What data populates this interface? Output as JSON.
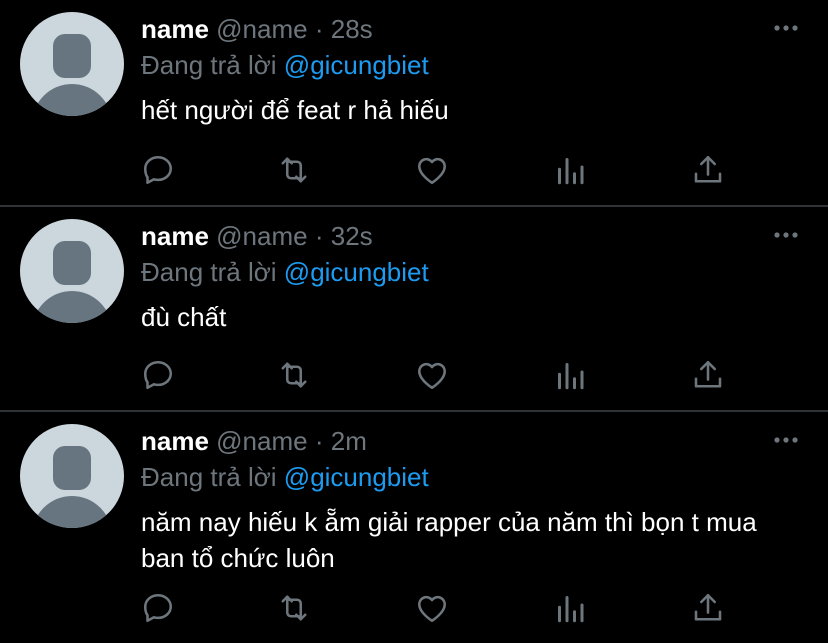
{
  "colors": {
    "background": "#000000",
    "divider": "#2f3336",
    "secondary_text": "#6e767d",
    "mention": "#1d9bf0",
    "avatar_bg": "#ccd6dd",
    "avatar_fg": "#66757f"
  },
  "reply_prefix": "Đang trả lời",
  "icons": {
    "more": "more-horizontal-icon",
    "reply": "reply-icon",
    "retweet": "retweet-icon",
    "like": "like-heart-icon",
    "stats": "analytics-icon",
    "share": "share-icon"
  },
  "tweets": [
    {
      "name": "name",
      "handle": "@name",
      "separator": "·",
      "time": "28s",
      "reply_to": "@gicungbiet",
      "text": "hết người để feat r hả hiếu"
    },
    {
      "name": "name",
      "handle": "@name",
      "separator": "·",
      "time": "32s",
      "reply_to": "@gicungbiet",
      "text": "đù chất"
    },
    {
      "name": "name",
      "handle": "@name",
      "separator": "·",
      "time": "2m",
      "reply_to": "@gicungbiet",
      "text": "năm nay hiếu k ẵm giải rapper của năm thì bọn t mua ban tổ chức luôn"
    }
  ]
}
